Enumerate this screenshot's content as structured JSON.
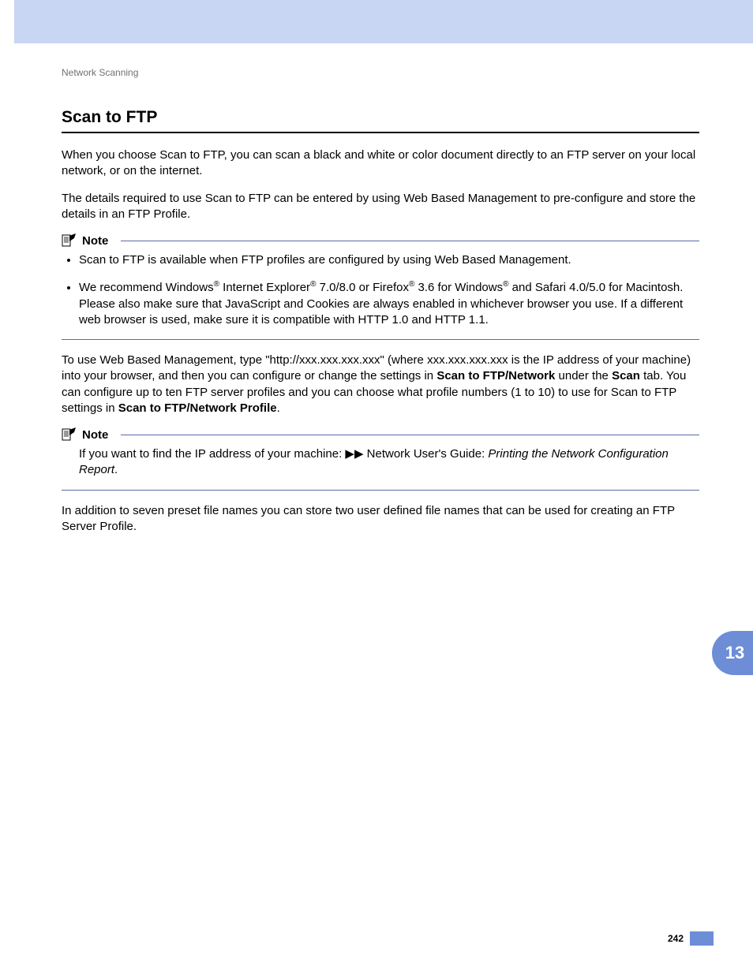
{
  "header": {
    "breadcrumb": "Network Scanning"
  },
  "section": {
    "title": "Scan to FTP",
    "intro1": "When you choose Scan to FTP, you can scan a black and white or color document directly to an FTP server on your local network, or on the internet.",
    "intro2": "The details required to use Scan to FTP can be entered by using Web Based Management to pre-configure and store the details in an FTP Profile."
  },
  "note1": {
    "label": "Note",
    "bullet1": "Scan to FTP is available when FTP profiles are configured by using Web Based Management.",
    "bullet2_pre": "We recommend Windows",
    "bullet2_mid1": " Internet Explorer",
    "bullet2_mid2": " 7.0/8.0 or Firefox",
    "bullet2_mid3": " 3.6 for Windows",
    "bullet2_tail": " and Safari 4.0/5.0 for Macintosh. Please also make sure that JavaScript and Cookies are always enabled in whichever browser you use. If a different web browser is used, make sure it is compatible with HTTP 1.0 and HTTP 1.1.",
    "reg": "®"
  },
  "mid_para": {
    "part1": "To use Web Based Management, type \"http://xxx.xxx.xxx.xxx\" (where xxx.xxx.xxx.xxx is the IP address of your machine) into your browser, and then you can configure or change the settings in ",
    "bold1": "Scan to FTP/Network",
    "part2": " under the ",
    "bold2": "Scan",
    "part3": " tab. You can configure up to ten FTP server profiles and you can choose what profile numbers (1 to 10) to use for Scan to FTP settings in ",
    "bold3": "Scan to FTP/Network Profile",
    "part4": "."
  },
  "note2": {
    "label": "Note",
    "text_pre": "If you want to find the IP address of your machine: ",
    "arrows": "▶▶",
    "text_mid": " Network User's Guide: ",
    "italic": "Printing the Network Configuration Report",
    "text_post": "."
  },
  "closing": "In addition to seven preset file names you can store two user defined file names that can be used for creating an FTP Server Profile.",
  "chapter": "13",
  "page": "242"
}
